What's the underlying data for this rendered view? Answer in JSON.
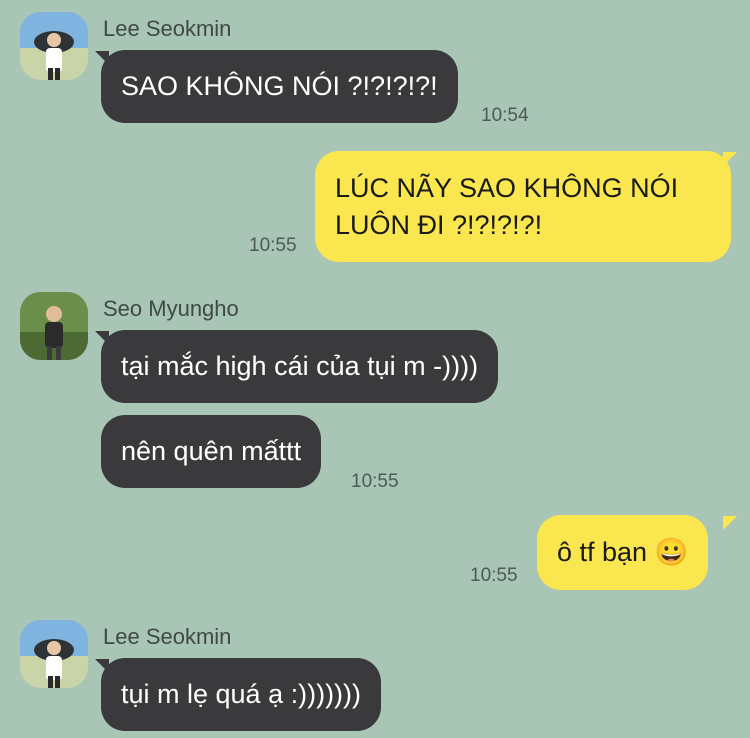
{
  "chat": {
    "messages": [
      {
        "sender": "Lee Seokmin",
        "text": "SAO KHÔNG NÓI ?!?!?!?!",
        "time": "10:54"
      },
      {
        "text": "LÚC NÃY SAO KHÔNG NÓI LUÔN ĐI ?!?!?!?!",
        "time": "10:55"
      },
      {
        "sender": "Seo Myungho",
        "text": "tại mắc high cái của tụi m -))))"
      },
      {
        "text": "nên quên mấttt",
        "time": "10:55"
      },
      {
        "text": "ô tf bạn 😀",
        "time": "10:55"
      },
      {
        "sender": "Lee Seokmin",
        "text": "tụi m lẹ quá ạ :)))))))"
      }
    ]
  },
  "colors": {
    "background": "#a8c5b6",
    "incoming_bubble": "#3a3a3c",
    "outgoing_bubble": "#fae64f"
  }
}
